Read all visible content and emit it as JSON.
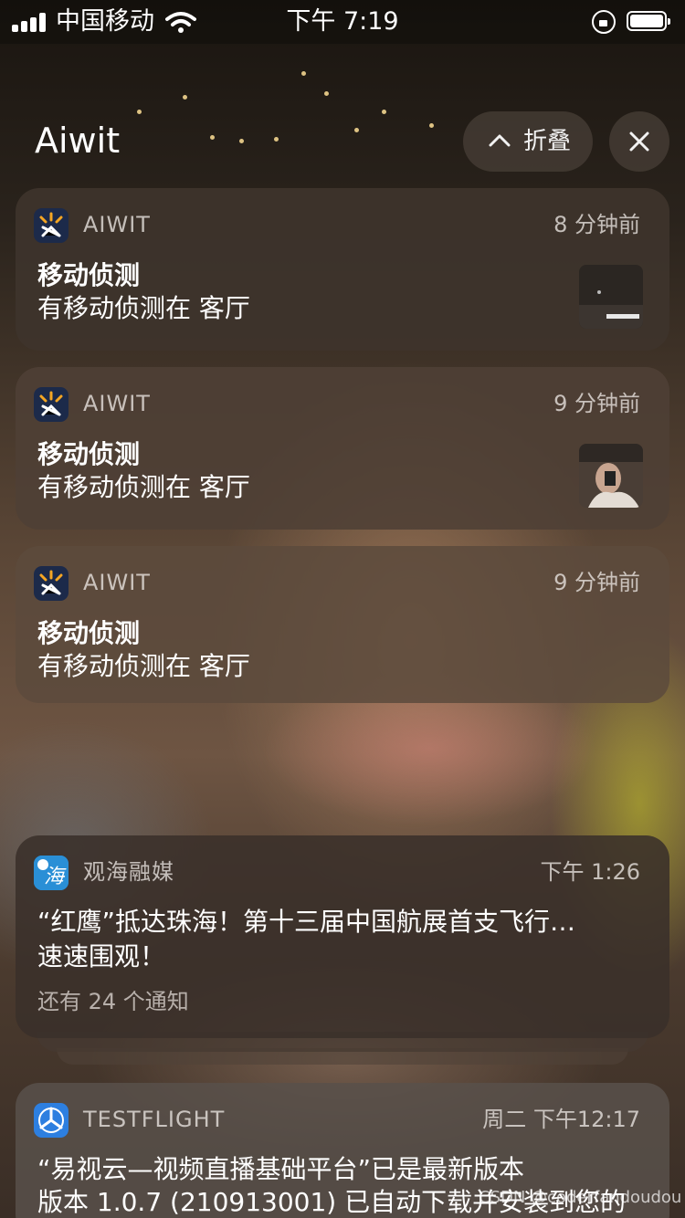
{
  "status_bar": {
    "carrier": "中国移动",
    "time": "下午 7:19"
  },
  "group": {
    "title": "Aiwit",
    "collapse_label": "折叠"
  },
  "notifications": [
    {
      "app": "AIWIT",
      "time": "8 分钟前",
      "title": "移动侦测",
      "body": "有移动侦测在 客厅"
    },
    {
      "app": "AIWIT",
      "time": "9 分钟前",
      "title": "移动侦测",
      "body": "有移动侦测在 客厅"
    },
    {
      "app": "AIWIT",
      "time": "9 分钟前",
      "title": "移动侦测",
      "body": "有移动侦测在 客厅"
    }
  ],
  "news": {
    "app": "观海融媒",
    "time": "下午 1:26",
    "title": "“红鹰”抵达珠海！第十三届中国航展首支飞行…",
    "body": "速速围观！",
    "more": "还有 24 个通知",
    "icon_char": "海"
  },
  "testflight": {
    "app": "TESTFLIGHT",
    "time": "周二 下午12:17",
    "title": "“易视云—视频直播基础平台”已是最新版本",
    "body": "版本 1.0.7 (210913001) 已自动下载并安装到您的"
  },
  "watermark": "CSDN @coderfandoudou",
  "colors": {
    "aiwit_icon_bg": "#1c2a4a",
    "aiwit_icon_accent": "#f5a623",
    "guanhai_icon_bg": "#2a8fd6",
    "testflight_icon_bg": "#2d7fe0"
  }
}
